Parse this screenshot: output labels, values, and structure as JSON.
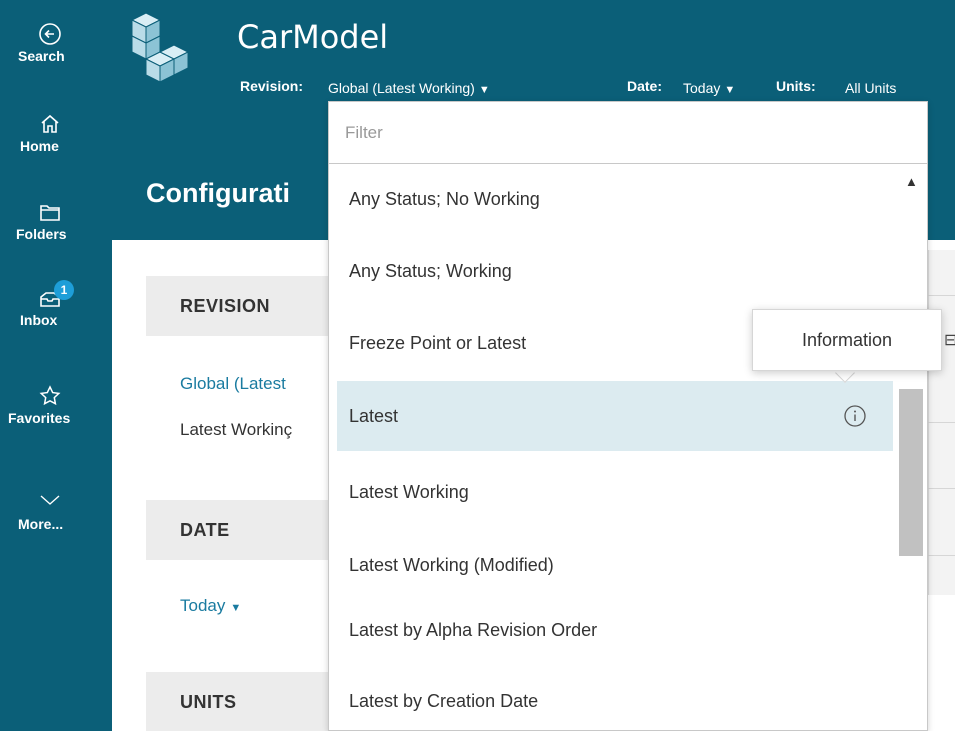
{
  "nav": {
    "search": "Search",
    "home": "Home",
    "folders": "Folders",
    "inbox": "Inbox",
    "inbox_badge": "1",
    "favorites": "Favorites",
    "more": "More..."
  },
  "header": {
    "app_title": "CarModel",
    "revision_label": "Revision:",
    "revision_value": "Global (Latest Working)",
    "date_label": "Date:",
    "date_value": "Today",
    "units_label": "Units:",
    "units_value": "All Units"
  },
  "page": {
    "title": "Configurati"
  },
  "sections": {
    "revision": {
      "heading": "REVISION",
      "link": "Global (Latest",
      "text": "Latest Workinç"
    },
    "date": {
      "heading": "DATE",
      "link": "Today"
    },
    "units": {
      "heading": "UNITS"
    }
  },
  "dropdown": {
    "filter_placeholder": "Filter",
    "options": [
      "Any Status; No Working",
      "Any Status; Working",
      "Freeze Point or Latest",
      "Latest",
      "Latest Working",
      "Latest Working (Modified)",
      "Latest by Alpha Revision Order",
      "Latest by Creation Date"
    ],
    "selected": "Latest"
  },
  "tooltip": {
    "text": "Information"
  },
  "colors": {
    "brand": "#0b5f78",
    "selected_bg": "#dcebf0",
    "link": "#1a7ba0",
    "badge": "#1e9ed8"
  }
}
